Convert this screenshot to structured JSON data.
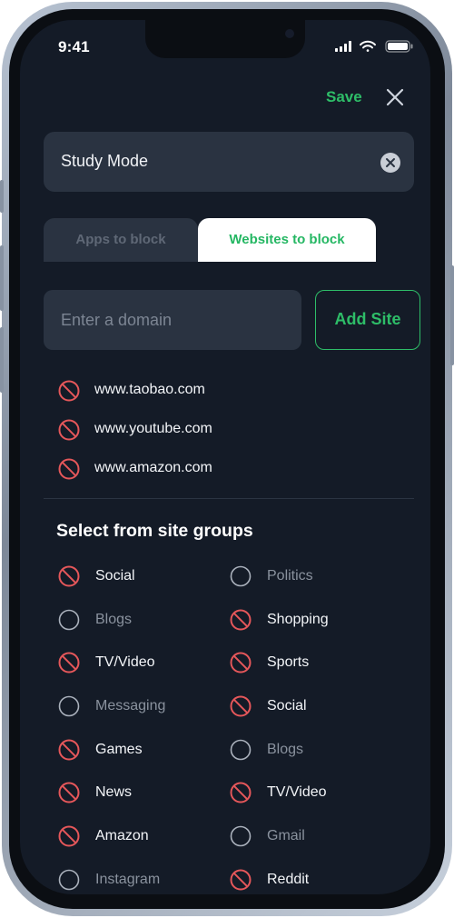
{
  "status_bar": {
    "time": "9:41"
  },
  "header": {
    "save_label": "Save"
  },
  "mode_name": {
    "value": "Study Mode"
  },
  "tabs": [
    {
      "label": "Apps to block",
      "active": false
    },
    {
      "label": "Websites to block",
      "active": true
    }
  ],
  "domain_input": {
    "placeholder": "Enter a domain",
    "value": ""
  },
  "add_site_label": "Add Site",
  "blocked_sites": [
    {
      "domain": "www.taobao.com"
    },
    {
      "domain": "www.youtube.com"
    },
    {
      "domain": "www.amazon.com"
    }
  ],
  "groups_title": "Select from site groups",
  "groups_left": [
    {
      "label": "Social",
      "selected": true
    },
    {
      "label": "Blogs",
      "selected": false
    },
    {
      "label": "TV/Video",
      "selected": true
    },
    {
      "label": "Messaging",
      "selected": false
    },
    {
      "label": "Games",
      "selected": true
    },
    {
      "label": "News",
      "selected": true
    },
    {
      "label": "Amazon",
      "selected": true
    },
    {
      "label": "Instagram",
      "selected": false
    }
  ],
  "groups_right": [
    {
      "label": "Politics",
      "selected": false
    },
    {
      "label": "Shopping",
      "selected": true
    },
    {
      "label": "Sports",
      "selected": true
    },
    {
      "label": "Social",
      "selected": true
    },
    {
      "label": "Blogs",
      "selected": false
    },
    {
      "label": "TV/Video",
      "selected": true
    },
    {
      "label": "Gmail",
      "selected": false
    },
    {
      "label": "Reddit",
      "selected": true
    }
  ],
  "colors": {
    "accent": "#2ebd68",
    "block": "#e5575a",
    "background": "#141b27"
  }
}
